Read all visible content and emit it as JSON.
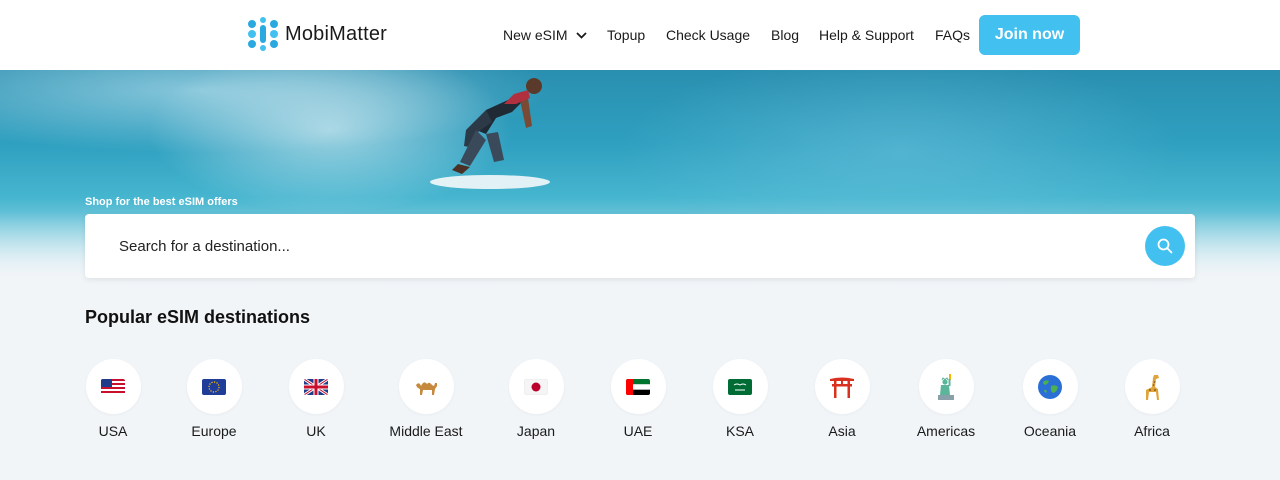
{
  "brand": {
    "name": "MobiMatter",
    "accent": "#42c0f0"
  },
  "nav": {
    "items": [
      {
        "label": "New eSIM",
        "has_dropdown": true
      },
      {
        "label": "Topup"
      },
      {
        "label": "Check Usage"
      },
      {
        "label": "Blog"
      },
      {
        "label": "Help & Support"
      },
      {
        "label": "FAQs"
      }
    ],
    "cta": "Join now"
  },
  "hero": {
    "tagline": "Shop for the best eSIM offers",
    "search_placeholder": "Search for a destination..."
  },
  "popular": {
    "title": "Popular eSIM destinations",
    "destinations": [
      {
        "label": "USA",
        "icon": "us-flag-icon"
      },
      {
        "label": "Europe",
        "icon": "eu-flag-icon"
      },
      {
        "label": "UK",
        "icon": "uk-flag-icon"
      },
      {
        "label": "Middle East",
        "icon": "camel-icon"
      },
      {
        "label": "Japan",
        "icon": "japan-flag-icon"
      },
      {
        "label": "UAE",
        "icon": "uae-flag-icon"
      },
      {
        "label": "KSA",
        "icon": "saudi-flag-icon"
      },
      {
        "label": "Asia",
        "icon": "torii-gate-icon"
      },
      {
        "label": "Americas",
        "icon": "statue-of-liberty-icon"
      },
      {
        "label": "Oceania",
        "icon": "globe-icon"
      },
      {
        "label": "Africa",
        "icon": "giraffe-icon"
      }
    ]
  }
}
